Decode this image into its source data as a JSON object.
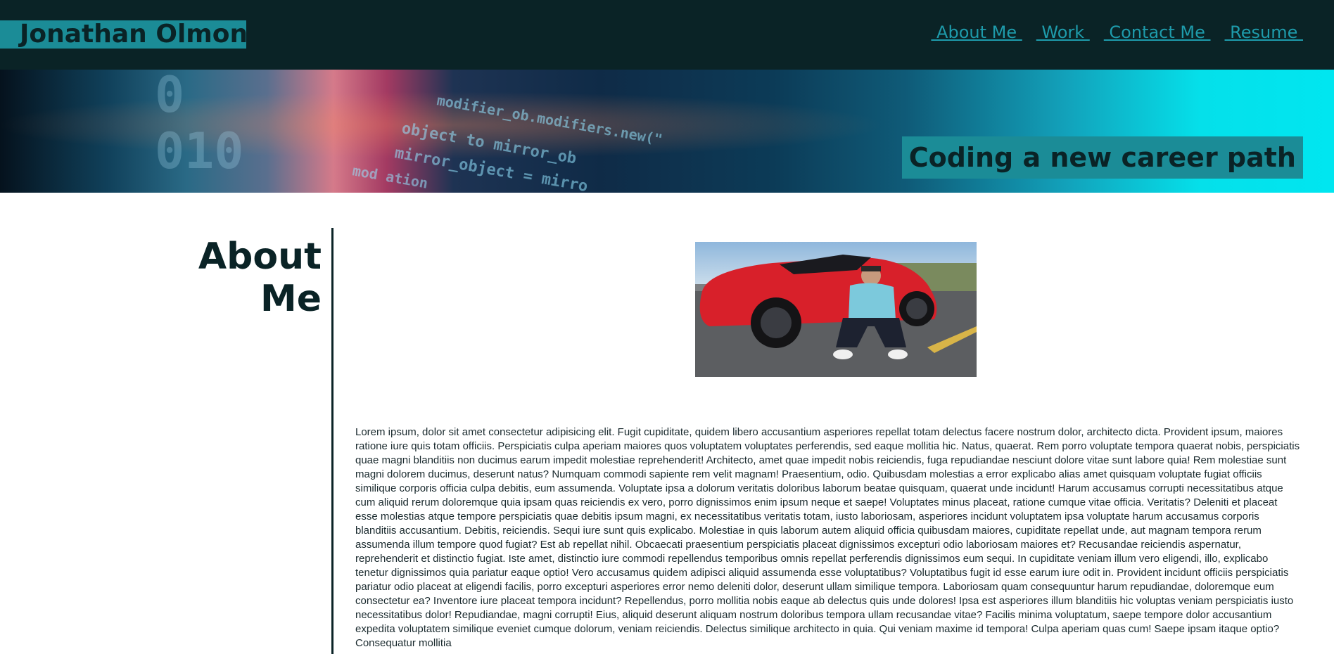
{
  "header": {
    "site_name": "Jonathan Olmon",
    "nav": [
      {
        "label": " About Me "
      },
      {
        "label": " Work "
      },
      {
        "label": " Contact Me "
      },
      {
        "label": " Resume "
      }
    ]
  },
  "banner": {
    "tagline": "Coding a new career path",
    "code_lines": [
      "modifier_ob.modifiers.new(\"",
      "object to mirror_ob",
      "mirror_object = mirro",
      "mod  ation",
      "0",
      "010"
    ]
  },
  "about": {
    "heading": "About Me",
    "photo_icon": "profile-photo",
    "bio": "Lorem ipsum, dolor sit amet consectetur adipisicing elit. Fugit cupiditate, quidem libero accusantium asperiores repellat totam delectus facere nostrum dolor, architecto dicta. Provident ipsum, maiores ratione iure quis totam officiis. Perspiciatis culpa aperiam maiores quos voluptatem voluptates perferendis, sed eaque mollitia hic. Natus, quaerat. Rem porro voluptate tempora quaerat nobis, perspiciatis quae magni blanditiis non ducimus earum impedit molestiae reprehenderit! Architecto, amet quae impedit nobis reiciendis, fuga repudiandae nesciunt dolore vitae sunt labore quia! Rem molestiae sunt magni dolorem ducimus, deserunt natus? Numquam commodi sapiente rem velit magnam! Praesentium, odio. Quibusdam molestias a error explicabo alias amet quisquam voluptate fugiat officiis similique corporis officia culpa debitis, eum assumenda. Voluptate ipsa a dolorum veritatis doloribus laborum beatae quisquam, quaerat unde incidunt! Harum accusamus corrupti necessitatibus atque cum aliquid rerum doloremque quia ipsam quas reiciendis ex vero, porro dignissimos enim ipsum neque et saepe! Voluptates minus placeat, ratione cumque vitae officia. Veritatis? Deleniti et placeat esse molestias atque tempore perspiciatis quae debitis ipsum magni, ex necessitatibus veritatis totam, iusto laboriosam, asperiores incidunt voluptatem ipsa voluptate harum accusamus corporis blanditiis accusantium. Debitis, reiciendis. Sequi iure sunt quis explicabo. Molestiae in quis laborum autem aliquid officia quibusdam maiores, cupiditate repellat unde, aut magnam tempora rerum assumenda illum tempore quod fugiat? Est ab repellat nihil. Obcaecati praesentium perspiciatis placeat dignissimos excepturi odio laboriosam maiores et? Recusandae reiciendis aspernatur, reprehenderit et distinctio fugiat. Iste amet, distinctio iure commodi repellendus temporibus omnis repellat perferendis dignissimos eum sequi. In cupiditate veniam illum vero eligendi, illo, explicabo tenetur dignissimos quia pariatur eaque optio! Vero accusamus quidem adipisci aliquid assumenda esse voluptatibus? Voluptatibus fugit id esse earum iure odit in. Provident incidunt officiis perspiciatis pariatur odio placeat at eligendi facilis, porro excepturi asperiores error nemo deleniti dolor, deserunt ullam similique tempora. Laboriosam quam consequuntur harum repudiandae, doloremque eum consectetur ea? Inventore iure placeat tempora incidunt? Repellendus, porro mollitia nobis eaque ab delectus quis unde dolores! Ipsa est asperiores illum blanditiis hic voluptas veniam perspiciatis iusto necessitatibus dolor! Repudiandae, magni corrupti! Eius, aliquid deserunt aliquam nostrum doloribus tempora ullam recusandae vitae? Facilis minima voluptatum, saepe tempore dolor accusantium expedita voluptatem similique eveniet cumque dolorum, veniam reiciendis. Delectus similique architecto in quia. Qui veniam maxime id tempora! Culpa aperiam quas cum! Saepe ipsam itaque optio? Consequatur mollitia"
  },
  "colors": {
    "header_bg": "#0a2326",
    "accent": "#1b8c97",
    "link": "#1e9bab",
    "text_dark": "#0a2326"
  }
}
